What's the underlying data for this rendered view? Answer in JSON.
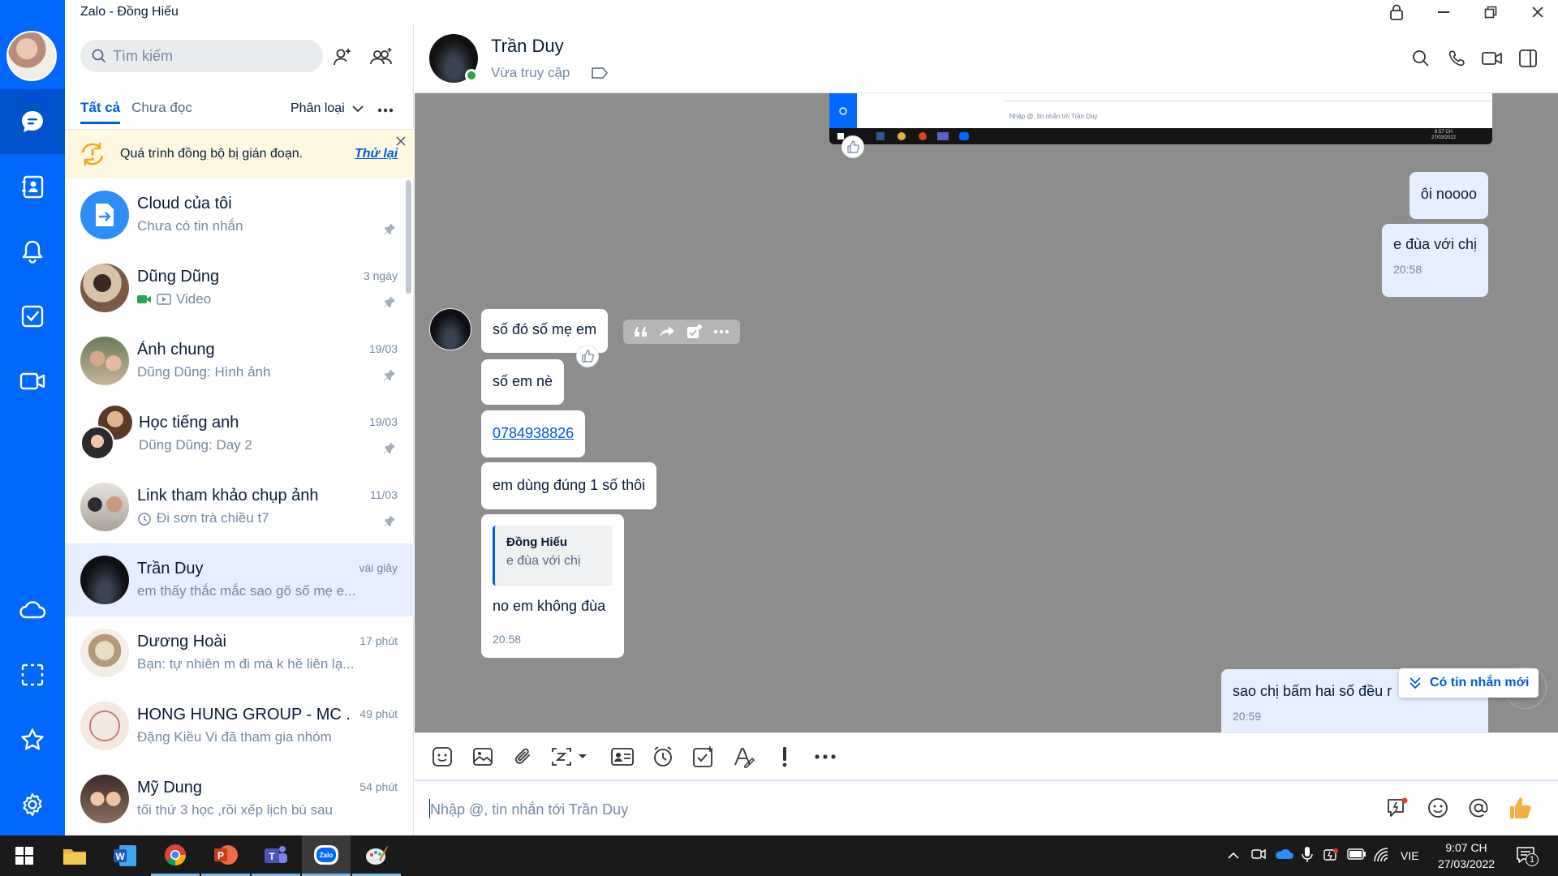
{
  "window": {
    "title": "Zalo - Đồng Hiếu"
  },
  "colors": {
    "brand": "#0068ff",
    "nav_active": "#0052cc",
    "selected_row": "#e5efff",
    "chat_bg": "#8d8d8d",
    "online": "#30a14e"
  },
  "nav": {
    "items": [
      "chat-icon",
      "contacts-icon",
      "bell-icon",
      "todo-icon",
      "video-call-icon",
      "cloud-icon",
      "screenshot-icon",
      "star-icon",
      "settings-icon"
    ],
    "active": "chat-icon"
  },
  "search": {
    "placeholder": "Tìm kiếm"
  },
  "tabs": {
    "all": "Tất cả",
    "unread": "Chưa đọc",
    "classify": "Phân loại"
  },
  "sync": {
    "message": "Quá trình đồng bộ bị gián đoạn.",
    "retry": "Thử lại"
  },
  "conversations": [
    {
      "name": "Cloud của tôi",
      "preview": "Chưa có tin nhắn",
      "time": "",
      "pinned": true
    },
    {
      "name": "Dũng Dũng",
      "preview": "Video",
      "time": "3 ngày",
      "pinned": true
    },
    {
      "name": "Ảnh chung",
      "preview": "Dũng Dũng: Hình ảnh",
      "time": "19/03",
      "pinned": true
    },
    {
      "name": "Học tiếng anh",
      "preview": "Dũng Dũng: Day 2",
      "time": "19/03",
      "pinned": true
    },
    {
      "name": "Link tham khảo chụp ảnh",
      "preview": "Đi sơn trà chiều t7",
      "time": "11/03",
      "pinned": true
    },
    {
      "name": "Trần Duy",
      "preview": "em thấy thắc mắc sao gõ số mẹ e...",
      "time": "vài giây",
      "pinned": false,
      "selected": true
    },
    {
      "name": "Dương Hoài",
      "preview": "Bạn: tự nhiên m đi mà k hề liên lạ...",
      "time": "17 phút",
      "pinned": false
    },
    {
      "name": "HONG HUNG GROUP - MC ...",
      "preview": "Đặng Kiều Vi đã tham gia nhóm",
      "time": "49 phút",
      "pinned": false
    },
    {
      "name": "Mỹ Dung",
      "preview": "tối thứ 3 học ,rồi xếp lịch bù sau",
      "time": "54 phút",
      "pinned": false
    }
  ],
  "chat": {
    "name": "Trần Duy",
    "status": "Vừa truy cập",
    "embedded_screenshot": {
      "placeholder": "Nhập @, tin nhắn tới Trần Duy",
      "clock_time": "8:57 CH",
      "clock_date": "27/03/2022"
    },
    "messages": [
      {
        "from": "me",
        "text": "ôi noooo",
        "time": ""
      },
      {
        "from": "me",
        "text": "e đùa với chị",
        "time": "20:58"
      },
      {
        "from": "them",
        "text": "số đó số mẹ em",
        "time": ""
      },
      {
        "from": "them",
        "text": "số em nè",
        "time": ""
      },
      {
        "from": "them",
        "text": "0784938826",
        "time": "",
        "link": true
      },
      {
        "from": "them",
        "text": "em dùng đúng 1 số thôi",
        "time": ""
      },
      {
        "from": "them",
        "text": "no em không đùa",
        "time": "20:58",
        "quote_author": "Đồng Hiếu",
        "quote_text": "e đùa với chị"
      },
      {
        "from": "me",
        "text": "sao chị bấm hai số đều r",
        "time": "20:59"
      }
    ],
    "new_message_notice": "Có tin nhắn mới"
  },
  "composer": {
    "placeholder": "Nhập @, tin nhắn tới Trần Duy"
  },
  "taskbar": {
    "language": "VIE",
    "time": "9:07 CH",
    "date": "27/03/2022",
    "notification_count": "1"
  }
}
